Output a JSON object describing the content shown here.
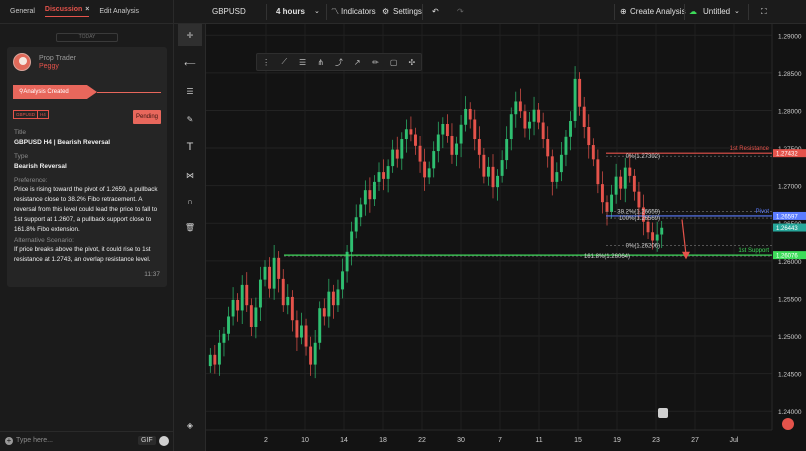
{
  "left_panel": {
    "tabs": {
      "general": "General",
      "discussion": "Discussion",
      "close": "×",
      "edit_analysis": "Edit Analysis"
    },
    "today_label": "TODAY",
    "user": {
      "name": "Prop Trader",
      "handle": "Peggy"
    },
    "analysis_created": "Analysis Created",
    "tags": {
      "symbol": "GBPUSD",
      "timeframe": "H4"
    },
    "status": "Pending",
    "title_label": "Title",
    "title_value": "GBPUSD H4 | Bearish Reversal",
    "type_label": "Type",
    "type_value": "Bearish Reversal",
    "preference_label": "Preference:",
    "preference_text": "Price is rising toward the pivot of 1.2659, a pullback resistance close to 38.2% Fibo retracement. A reversal from this level could lead the price to fall to 1st support at 1.2607, a pullback support close to 161.8% Fibo extension.",
    "alt_label": "Alternative Scenario:",
    "alt_text": "If price breaks above the pivot, it could rise to 1st resistance at 1.2743, an overlap resistance level.",
    "time": "11:37",
    "input_placeholder": "Type here...",
    "gif_label": "GIF"
  },
  "topbar": {
    "symbol": "GBPUSD",
    "timeframe": "4 hours",
    "indicators": "Indicators",
    "settings": "Settings",
    "create_analysis": "Create Analysis",
    "untitled": "Untitled"
  },
  "icons": {
    "toolbar": [
      "crosshair-icon",
      "horizontal-line-icon",
      "fib-retracement-icon",
      "brush-icon",
      "text-icon",
      "pattern-icon",
      "magnet-icon",
      "trash-icon",
      "layers-icon"
    ]
  },
  "colors": {
    "accent": "#e5534b",
    "bull": "#2fbf71",
    "bear": "#e5534b",
    "support": "#3ddc5a",
    "resistance": "#e5534b",
    "pivot": "#5b7cff"
  },
  "chart_data": {
    "type": "candlestick",
    "symbol": "GBPUSD",
    "timeframe": "4 hours",
    "price_ticks": [
      "1.29000",
      "1.28500",
      "1.28000",
      "1.27500",
      "1.27000",
      "1.26500",
      "1.26000",
      "1.25500",
      "1.25000",
      "1.24500",
      "1.24000"
    ],
    "date_ticks": [
      "2",
      "10",
      "14",
      "18",
      "22",
      "30",
      "7",
      "11",
      "15",
      "19",
      "23",
      "27",
      "Jul"
    ],
    "ylim": [
      1.2375,
      1.2915
    ],
    "price_labels": [
      {
        "text": "1.27432",
        "color": "#e5534b",
        "price": 1.27432
      },
      {
        "text": "1.26597",
        "color": "#5b7cff",
        "price": 1.26597
      },
      {
        "text": "1.26443",
        "color": "#26a69a",
        "price": 1.26443
      },
      {
        "text": "1.26076",
        "color": "#3ddc5a",
        "price": 1.26076
      }
    ],
    "levels": [
      {
        "name": "1st Resistance",
        "price": 1.27432,
        "color": "#e5534b"
      },
      {
        "name": "Pivot",
        "price": 1.26597,
        "color": "#5b7cff"
      },
      {
        "name": "1st Support",
        "price": 1.26076,
        "color": "#3ddc5a"
      }
    ],
    "fib_labels": [
      "0%(1.27392)",
      "38.2%(1.26659)",
      "100%(1.26569)",
      "0%(1.26206)",
      "161.8%(1.26064)"
    ],
    "closes": [
      1.2475,
      1.2462,
      1.2491,
      1.2503,
      1.2526,
      1.2548,
      1.2534,
      1.2568,
      1.2541,
      1.2512,
      1.2538,
      1.2575,
      1.2592,
      1.2563,
      1.2604,
      1.2576,
      1.2541,
      1.2552,
      1.2521,
      1.2498,
      1.2514,
      1.2486,
      1.2462,
      1.2491,
      1.2537,
      1.2526,
      1.2559,
      1.2541,
      1.2562,
      1.2586,
      1.2612,
      1.2639,
      1.2658,
      1.2675,
      1.2694,
      1.2682,
      1.2705,
      1.2718,
      1.2709,
      1.2726,
      1.2748,
      1.2736,
      1.2762,
      1.2775,
      1.2768,
      1.2753,
      1.2732,
      1.2711,
      1.2723,
      1.2746,
      1.2768,
      1.2782,
      1.2766,
      1.2741,
      1.2756,
      1.2781,
      1.2802,
      1.2788,
      1.2762,
      1.2741,
      1.2712,
      1.2725,
      1.2698,
      1.2713,
      1.2734,
      1.2762,
      1.2795,
      1.2812,
      1.2799,
      1.2776,
      1.2785,
      1.2801,
      1.2784,
      1.2762,
      1.2739,
      1.2705,
      1.2718,
      1.2741,
      1.2765,
      1.2786,
      1.2842,
      1.2805,
      1.2778,
      1.2754,
      1.2735,
      1.2702,
      1.2678,
      1.2665,
      1.2688,
      1.2712,
      1.2696,
      1.2724,
      1.2713,
      1.2692,
      1.2671,
      1.2652,
      1.2638,
      1.2627,
      1.2635,
      1.2644
    ]
  }
}
